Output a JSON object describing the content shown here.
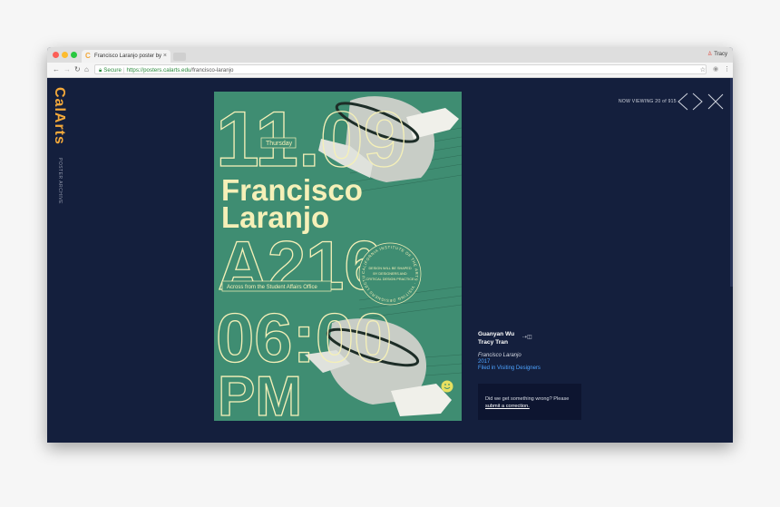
{
  "browser": {
    "tab_title": "Francisco Laranjo poster by Gu",
    "tab_close": "×",
    "profile_name": "Tracy",
    "secure_label": "Secure",
    "url_host": "https://posters.calarts.edu",
    "url_path": "/francisco-laranjo"
  },
  "site": {
    "logo": "CalArts",
    "logo_sub": "POSTER ARCHIVE"
  },
  "viewer": {
    "now_viewing": "NOW VIEWING 20 of 915"
  },
  "poster": {
    "date": "11.09",
    "day": "Thursday",
    "name_first": "Francisco",
    "name_last": "Laranjo",
    "room": "A216",
    "location": "Across from the Student Affairs Office",
    "time": "06:00",
    "ampm": "PM",
    "circle_text": "CALIFORNIA INSTITUTE OF THE ARTS · VISITING DESIGNERS LECTURE SERIES ·",
    "blurb_1": "DESIGN WILL BE SHAPED",
    "blurb_2": "BY DESIGNERS AND",
    "blurb_3": "CRITICAL DESIGN PRACTICE"
  },
  "credits": {
    "designer_1": "Guanyan Wu",
    "designer_2": "Tracy Tran",
    "work_title": "Francisco Laranjo",
    "year": "2017",
    "filed": "Filed in Visiting Designers"
  },
  "correction": {
    "text": "Did we get something wrong? Please",
    "link": "submit a correction."
  },
  "colors": {
    "accent": "#f3a83a",
    "background": "#141f3d",
    "poster_green": "#3f8d72",
    "poster_cream": "#f5f0b8",
    "link_blue": "#4da3ff"
  }
}
